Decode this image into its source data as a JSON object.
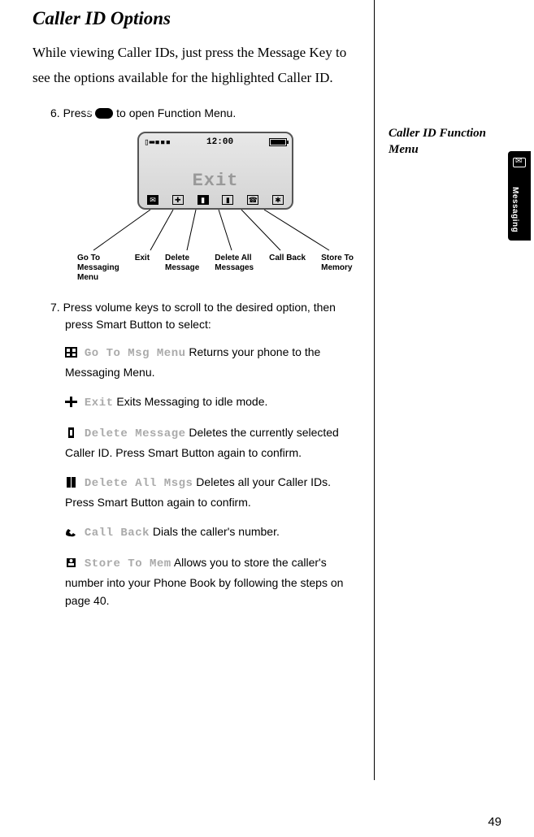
{
  "title": "Caller ID Options",
  "intro": "While viewing Caller IDs, just press the Message Key to see the options available for the highlighted Caller ID.",
  "step6_prefix": "6. Press ",
  "step6_suffix": " to open Function Menu.",
  "screen": {
    "time": "12:00",
    "text": "Exit"
  },
  "callouts": {
    "goto": "Go To\nMessaging\nMenu",
    "exit": "Exit",
    "deletemsg": "Delete\nMessage",
    "deleteall": "Delete All\nMessages",
    "callback": "Call Back",
    "store": "Store To\nMemory"
  },
  "step7": "7. Press volume keys to scroll to the desired option, then press Smart Button to select:",
  "options": {
    "goto_label": "Go To Msg Menu",
    "goto_desc": " Returns your phone to the Messaging Menu.",
    "exit_label": "Exit",
    "exit_desc": "  Exits Messaging to idle mode.",
    "del_label": "Delete Message",
    "del_desc": "  Deletes the currently selected Caller ID. Press Smart Button again to confirm.",
    "delall_label": "Delete All Msgs",
    "delall_desc": "  Deletes all your Caller IDs. Press Smart Button again to confirm.",
    "cb_label": "Call Back",
    "cb_desc": "  Dials the caller's number.",
    "store_label": "Store To Mem",
    "store_desc": "  Allows you to store the caller's number into your Phone Book by following the steps on page 40."
  },
  "side_annotation": "Caller ID Function Menu",
  "tab_label": "Messaging",
  "page_number": "49"
}
